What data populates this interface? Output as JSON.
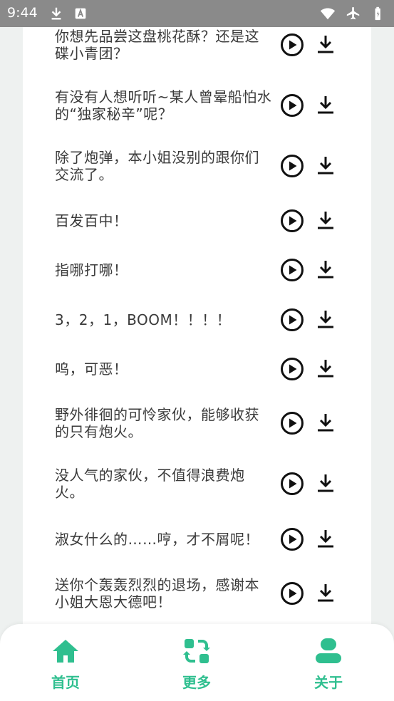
{
  "status_bar": {
    "time": "9:44",
    "left_icons": [
      "download-icon",
      "font-a-icon"
    ],
    "right_icons": [
      "wifi-icon",
      "airplane-icon",
      "battery-icon"
    ]
  },
  "voice_lines": [
    {
      "text": "你想先品尝这盘桃花酥？还是这碟小青团？",
      "play_icon": "play-circle-icon",
      "download_icon": "download-icon"
    },
    {
      "text": "有没有人想听听~某人曾晕船怕水的“独家秘辛”呢？",
      "play_icon": "play-circle-icon",
      "download_icon": "download-icon"
    },
    {
      "text": "除了炮弹，本小姐没别的跟你们交流了。",
      "play_icon": "play-circle-icon",
      "download_icon": "download-icon"
    },
    {
      "text": "百发百中！",
      "play_icon": "play-circle-icon",
      "download_icon": "download-icon"
    },
    {
      "text": "指哪打哪！",
      "play_icon": "play-circle-icon",
      "download_icon": "download-icon"
    },
    {
      "text": "3，2，1，BOOM！！！！",
      "play_icon": "play-circle-icon",
      "download_icon": "download-icon"
    },
    {
      "text": "呜，可恶！",
      "play_icon": "play-circle-icon",
      "download_icon": "download-icon"
    },
    {
      "text": "野外徘徊的可怜家伙，能够收获的只有炮火。",
      "play_icon": "play-circle-icon",
      "download_icon": "download-icon"
    },
    {
      "text": "没人气的家伙，不值得浪费炮火。",
      "play_icon": "play-circle-icon",
      "download_icon": "download-icon"
    },
    {
      "text": "淑女什么的……哼，才不屑呢！",
      "play_icon": "play-circle-icon",
      "download_icon": "download-icon"
    },
    {
      "text": "送你个轰轰烈烈的退场，感谢本小姐大恩大德吧！",
      "play_icon": "play-circle-icon",
      "download_icon": "download-icon"
    }
  ],
  "bottom_nav": {
    "items": [
      {
        "label": "首页",
        "icon": "home-icon"
      },
      {
        "label": "更多",
        "icon": "swap-icon"
      },
      {
        "label": "关于",
        "icon": "user-icon"
      }
    ],
    "accent_color": "#2fbf8f"
  }
}
